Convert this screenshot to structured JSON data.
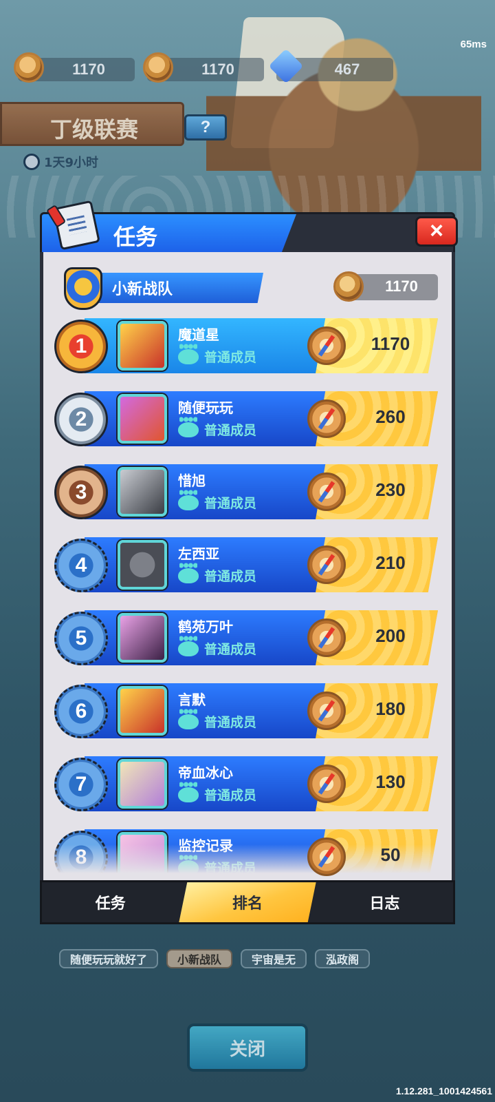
{
  "status": {
    "ping": "65ms"
  },
  "resources": [
    {
      "icon": "compass-coin-icon",
      "value": "1170"
    },
    {
      "icon": "gold-coin-icon",
      "value": "1170"
    },
    {
      "icon": "blue-gem-icon",
      "value": "467"
    }
  ],
  "league": {
    "title": "丁级联赛",
    "help": "?",
    "timer": "1天9小时"
  },
  "dialog": {
    "title": "任务",
    "close": "×",
    "team": {
      "name": "小新战队",
      "score": "1170"
    },
    "members": [
      {
        "rank": "1",
        "name": "魔道星",
        "role": "普通成员",
        "score": "1170"
      },
      {
        "rank": "2",
        "name": "随便玩玩",
        "role": "普通成员",
        "score": "260"
      },
      {
        "rank": "3",
        "name": "惜旭",
        "role": "普通成员",
        "score": "230"
      },
      {
        "rank": "4",
        "name": "左西亚",
        "role": "普通成员",
        "score": "210"
      },
      {
        "rank": "5",
        "name": "鹤苑万叶",
        "role": "普通成员",
        "score": "200"
      },
      {
        "rank": "6",
        "name": "言默",
        "role": "普通成员",
        "score": "180"
      },
      {
        "rank": "7",
        "name": "帝血冰心",
        "role": "普通成员",
        "score": "130"
      },
      {
        "rank": "8",
        "name": "监控记录",
        "role": "普通成员",
        "score": "50"
      }
    ],
    "tabs": [
      {
        "label": "任务",
        "active": false
      },
      {
        "label": "排名",
        "active": true
      },
      {
        "label": "日志",
        "active": false
      }
    ]
  },
  "team_chips": [
    {
      "label": "随便玩玩就好了",
      "selected": false
    },
    {
      "label": "小新战队",
      "selected": true
    },
    {
      "label": "宇宙是无",
      "selected": false
    },
    {
      "label": "泓政阁",
      "selected": false
    }
  ],
  "footer": {
    "close_label": "关闭",
    "version": "1.12.281_1001424561"
  }
}
